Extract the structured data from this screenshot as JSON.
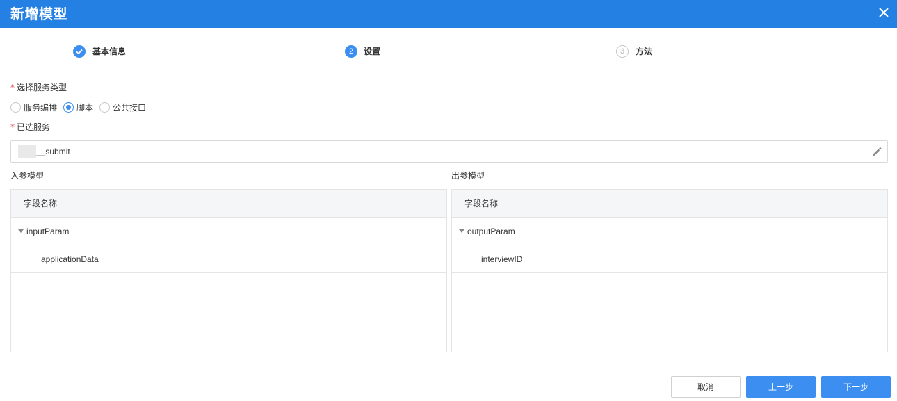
{
  "dialog": {
    "title": "新增模型"
  },
  "steps": [
    {
      "label": "基本信息",
      "number": "1",
      "status": "done"
    },
    {
      "label": "设置",
      "number": "2",
      "status": "active"
    },
    {
      "label": "方法",
      "number": "3",
      "status": "todo"
    }
  ],
  "form": {
    "service_type_label": "选择服务类型",
    "required_mark": "*",
    "service_type_options": [
      {
        "label": "服务编排",
        "checked": false
      },
      {
        "label": "脚本",
        "checked": true
      },
      {
        "label": "公共接口",
        "checked": false
      }
    ],
    "selected_service_label": "已选服务",
    "selected_service_value": "__submit"
  },
  "input_model": {
    "label": "入参模型",
    "column_header": "字段名称",
    "rows": [
      {
        "name": "inputParam",
        "expandable": true
      },
      {
        "name": "applicationData",
        "expandable": false
      }
    ]
  },
  "output_model": {
    "label": "出参模型",
    "column_header": "字段名称",
    "rows": [
      {
        "name": "outputParam",
        "expandable": true
      },
      {
        "name": "interviewID",
        "expandable": false
      }
    ]
  },
  "footer": {
    "cancel_label": "取消",
    "prev_label": "上一步",
    "next_label": "下一步"
  },
  "colors": {
    "header_bg": "#2580e3",
    "primary": "#3c8ff0",
    "required": "#e54545"
  },
  "icons": {
    "close": "close-icon",
    "check": "check-icon",
    "edit": "pencil-icon",
    "expand": "caret-down-icon"
  }
}
